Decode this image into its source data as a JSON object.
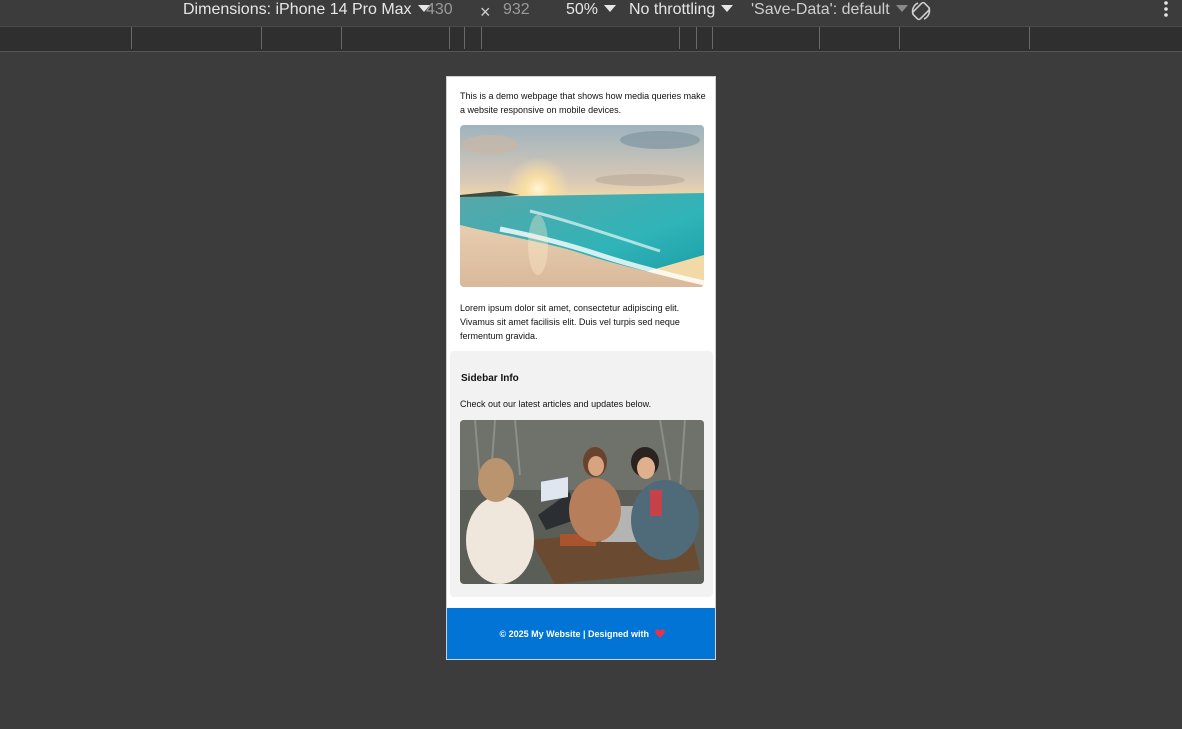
{
  "toolbar": {
    "device_label": "Dimensions: iPhone 14 Pro Max",
    "width": "430",
    "height": "932",
    "zoom": "50%",
    "throttling": "No throttling",
    "save_data": "'Save-Data': default"
  },
  "page": {
    "intro": "This is a demo webpage that shows how media queries make a website responsive on mobile devices.",
    "lorem": "Lorem ipsum dolor sit amet, consectetur adipiscing elit. Vivamus sit amet facilisis elit. Duis vel turpis sed neque fermentum gravida.",
    "sidebar_title": "Sidebar Info",
    "sidebar_text": "Check out our latest articles and updates below.",
    "footer": "© 2025 My Website | Designed with"
  },
  "icons": {
    "dimensions_caret": "chevron-down-icon",
    "zoom_caret": "chevron-down-icon",
    "throttling_caret": "chevron-down-icon",
    "save_data_caret": "chevron-down-icon",
    "rotate": "rotate-icon",
    "more": "kebab-icon",
    "heart": "heart-icon"
  },
  "colors": {
    "footer_bg": "#0174d6",
    "sidebar_bg": "#f2f2f2",
    "heart": "#e8334a"
  }
}
